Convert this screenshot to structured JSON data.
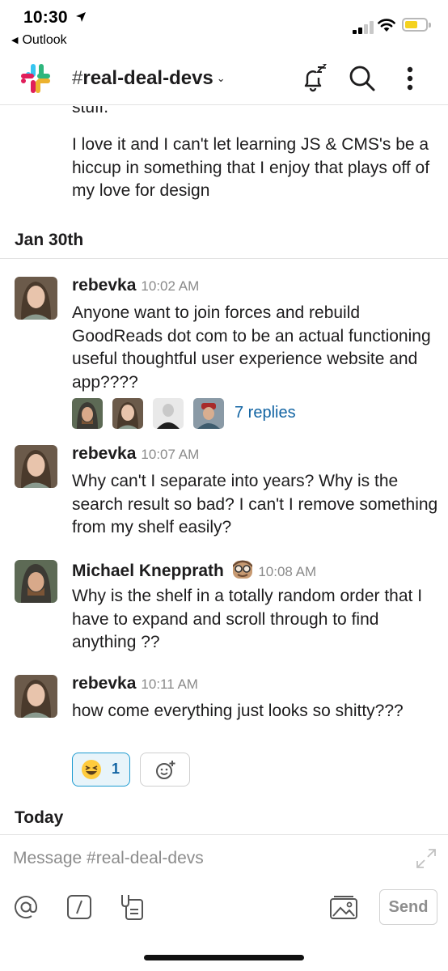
{
  "status_bar": {
    "time": "10:30",
    "back_app": "Outlook",
    "battery_color": "#f4d21f"
  },
  "header": {
    "channel_name": "real-deal-devs",
    "icons": [
      "slack-logo-icon",
      "snooze-bell-icon",
      "search-icon",
      "more-vertical-icon"
    ]
  },
  "continued_message": {
    "line1": "stuff.",
    "paragraph": "I love it and I can't let learning JS & CMS's be a hiccup in something that I enjoy that plays off of my love for design"
  },
  "days": {
    "jan30": "Jan 30th",
    "today": "Today"
  },
  "messages": [
    {
      "author": "rebevka",
      "time": "10:02 AM",
      "text": "Anyone want to join forces and rebuild GoodReads dot com to be an actual functioning useful thoughtful user experience website and app????",
      "replies": "7 replies"
    },
    {
      "author": "rebevka",
      "time": "10:07 AM",
      "text": "Why can't I separate into years? Why is the search result so bad? I can't I remove something from my shelf easily?"
    },
    {
      "author": "Michael Knepprath",
      "time": "10:08 AM",
      "text": "Why is the shelf in a totally random order that I have to expand and scroll through to find anything ??"
    },
    {
      "author": "rebevka",
      "time": "10:11 AM",
      "text": "how come everything just looks so shitty???",
      "reaction_count": "1"
    }
  ],
  "composer": {
    "placeholder": "Message #real-deal-devs",
    "send_label": "Send"
  },
  "colors": {
    "link": "#1264a3",
    "reaction_bg": "#e8f4fa",
    "reaction_border": "#1d9bd1"
  }
}
